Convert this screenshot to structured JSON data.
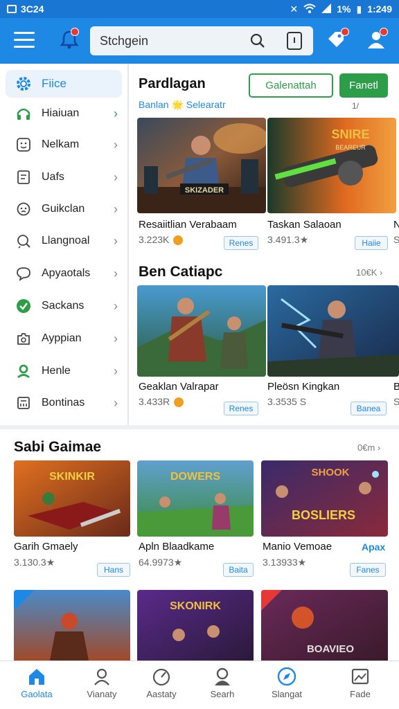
{
  "status_bar": {
    "left_text": "3C24",
    "battery": "1%",
    "time": "1:249"
  },
  "header": {
    "search": {
      "placeholder": "Stchgein"
    }
  },
  "sidebar": {
    "items": [
      {
        "label": "Fiice"
      },
      {
        "label": "Hiaiuan"
      },
      {
        "label": "Nelkam"
      },
      {
        "label": "Uafs"
      },
      {
        "label": "Guikclan"
      },
      {
        "label": "Llangnoal"
      },
      {
        "label": "Apyaotals"
      },
      {
        "label": "Sackans"
      },
      {
        "label": "Ayppian"
      },
      {
        "label": "Henle"
      },
      {
        "label": "Bontinas"
      }
    ]
  },
  "featured": {
    "title": "Pardlagan",
    "subtitle": "Banlan 🌟 Selearatr",
    "count": "1/",
    "outline_button": "Galenattah",
    "filled_button": "Fanetl",
    "cards": [
      {
        "name": "Resaiitlian Verabaam",
        "rating": "3.223K",
        "tag": "Renes"
      },
      {
        "name": "Taskan Salaoan",
        "rating": "3.491.3★",
        "tag": "Haiie"
      },
      {
        "name": "N",
        "rating": "S",
        "tag": ""
      }
    ]
  },
  "ben_section": {
    "title": "Ben Catiapc",
    "see_more": "10€K ›",
    "cards": [
      {
        "name": "Geaklan Valrapar",
        "rating": "3.433R",
        "tag": "Renes"
      },
      {
        "name": "Pleösn Kingkan",
        "rating": "3.3535 S",
        "tag": "Banea"
      },
      {
        "name": "B",
        "rating": "S",
        "tag": ""
      }
    ]
  },
  "saki_section": {
    "title": "Sabi Gaimae",
    "see_more": "0€m ›",
    "cards": [
      {
        "name": "Garih Gmaely",
        "rating": "3.130.3★",
        "tag": "Hans",
        "extra": ""
      },
      {
        "name": "Apln Blaadkame",
        "rating": "64.9973★",
        "tag": "Baita",
        "extra": ""
      },
      {
        "name": "Manio Vemoae",
        "rating": "3.13933★",
        "tag": "Fanes",
        "extra": "Apax"
      }
    ]
  },
  "bottom_nav": {
    "items": [
      {
        "label": "Gaolata"
      },
      {
        "label": "Vianaty"
      },
      {
        "label": "Aastaty"
      },
      {
        "label": "Searh"
      },
      {
        "label": "Slangat"
      },
      {
        "label": "Fade"
      }
    ]
  },
  "colors": {
    "header_blue": "#1e88e5",
    "accent_green": "#2e9d4a",
    "badge_red": "#e53935"
  }
}
